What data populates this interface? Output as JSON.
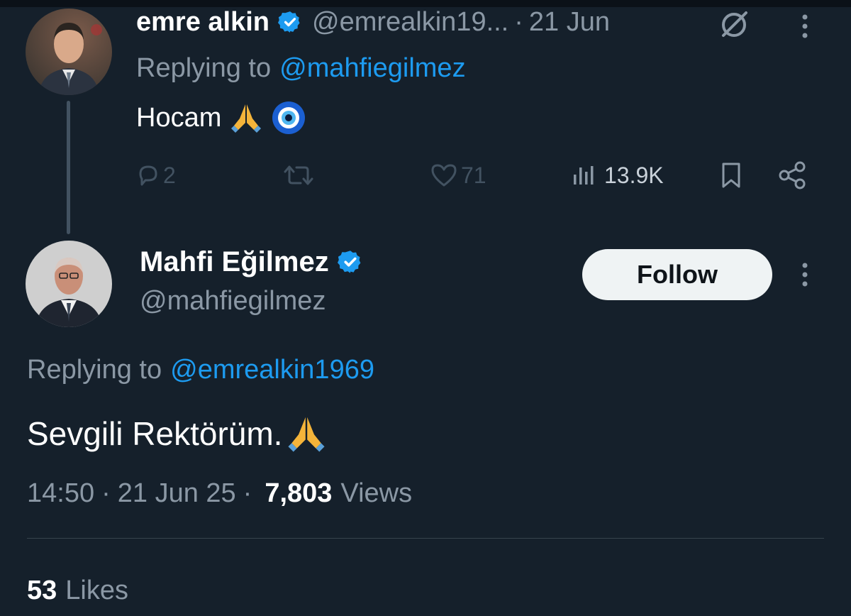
{
  "parent_tweet": {
    "author_name": "emre alkin",
    "handle": "@emrealkin19...",
    "separator": "·",
    "date": "21 Jun",
    "replying_prefix": "Replying to",
    "replying_to": "@mahfiegilmez",
    "text": "Hocam",
    "emojis": [
      "folded-hands",
      "nazar-amulet"
    ],
    "actions": {
      "replies": "2",
      "retweets": "",
      "likes": "71",
      "views": "13.9K"
    }
  },
  "main_tweet": {
    "author_name": "Mahfi Eğilmez",
    "handle": "@mahfiegilmez",
    "follow_label": "Follow",
    "replying_prefix": "Replying to",
    "replying_to": "@emrealkin1969",
    "text": "Sevgili Rektörüm.",
    "emoji": "folded-hands",
    "time": "14:50",
    "separator": "·",
    "date": "21 Jun 25",
    "views_count": "7,803",
    "views_label": "Views",
    "likes_count": "53",
    "likes_label": "Likes"
  },
  "colors": {
    "background": "#15202b",
    "link": "#1d9bf0",
    "muted": "#8b98a5",
    "verified": "#1d9bf0"
  }
}
